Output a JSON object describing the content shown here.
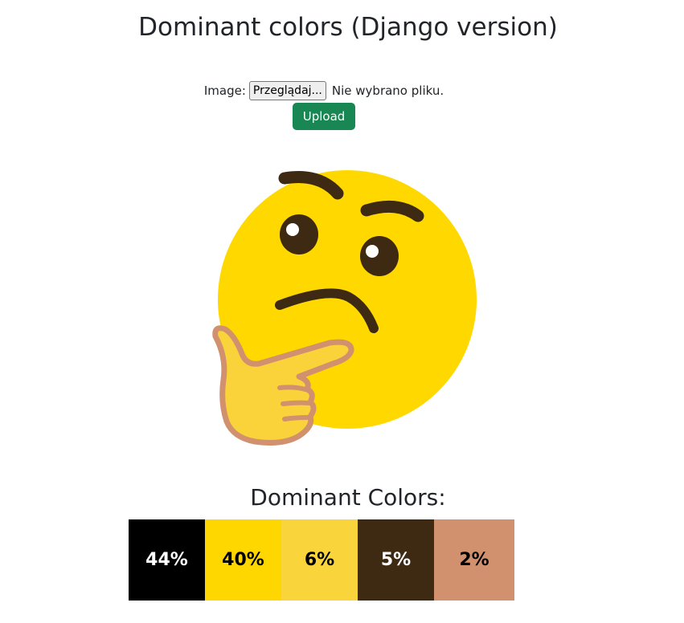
{
  "page": {
    "title": "Dominant colors (Django version)"
  },
  "form": {
    "image_label": "Image:",
    "browse_button": "Przeglądaj...",
    "file_status": "Nie wybrano pliku.",
    "upload_button": "Upload"
  },
  "preview": {
    "icon": "thinking-face-emoji"
  },
  "results": {
    "heading": "Dominant Colors:",
    "swatches": [
      {
        "percent": "44%",
        "color": "#000000",
        "text_color": "#ffffff"
      },
      {
        "percent": "40%",
        "color": "#FFD700",
        "text_color": "#000000"
      },
      {
        "percent": "6%",
        "color": "#F9D43A",
        "text_color": "#000000"
      },
      {
        "percent": "5%",
        "color": "#3E2A12",
        "text_color": "#ffffff"
      },
      {
        "percent": "2%",
        "color": "#D1916F",
        "text_color": "#000000"
      }
    ]
  }
}
